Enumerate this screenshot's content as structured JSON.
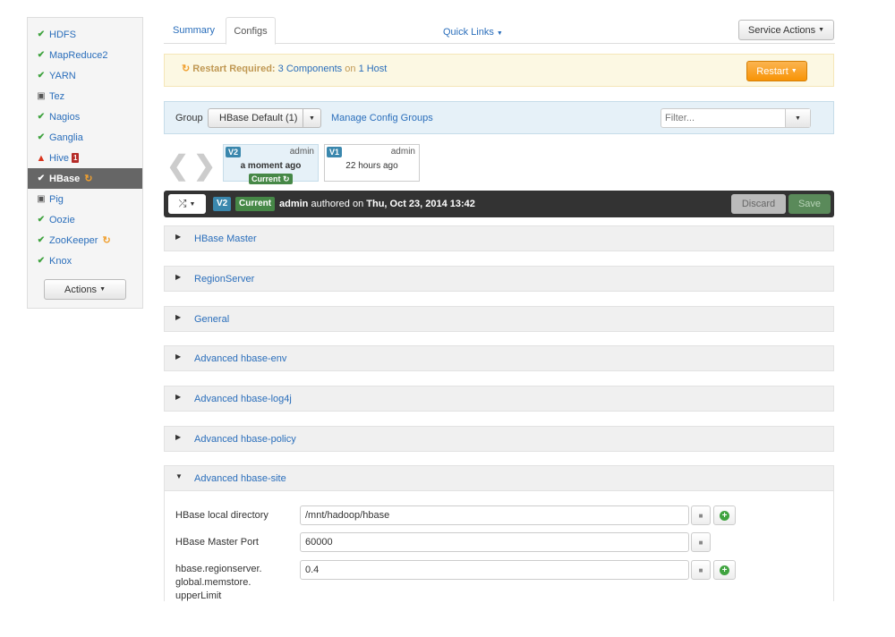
{
  "sidebar": {
    "services": [
      {
        "name": "HDFS",
        "status": "ok"
      },
      {
        "name": "MapReduce2",
        "status": "ok"
      },
      {
        "name": "YARN",
        "status": "ok"
      },
      {
        "name": "Tez",
        "status": "client"
      },
      {
        "name": "Nagios",
        "status": "ok"
      },
      {
        "name": "Ganglia",
        "status": "ok"
      },
      {
        "name": "Hive",
        "status": "alert",
        "badge": "1"
      },
      {
        "name": "HBase",
        "status": "ok",
        "active": true,
        "restart": true
      },
      {
        "name": "Pig",
        "status": "client"
      },
      {
        "name": "Oozie",
        "status": "ok"
      },
      {
        "name": "ZooKeeper",
        "status": "ok",
        "restart": true
      },
      {
        "name": "Knox",
        "status": "ok"
      }
    ],
    "actions_label": "Actions"
  },
  "tabs": {
    "summary": "Summary",
    "configs": "Configs"
  },
  "quick_links": "Quick Links",
  "service_actions": "Service Actions",
  "alert": {
    "prefix": "Restart Required:",
    "components": "3 Components",
    "on": "on",
    "hosts": "1 Host",
    "restart_label": "Restart"
  },
  "group_bar": {
    "label": "Group",
    "selected": "HBase Default (1)",
    "manage_link": "Manage Config Groups",
    "filter_placeholder": "Filter..."
  },
  "versions": {
    "v2": {
      "tag": "V2",
      "author": "admin",
      "time": "a moment ago",
      "current": "Current"
    },
    "v1": {
      "tag": "V1",
      "author": "admin",
      "time": "22 hours ago"
    }
  },
  "version_bar": {
    "tag": "V2",
    "current": "Current",
    "author": "admin",
    "authored_on": "authored on",
    "date": "Thu, Oct 23, 2014 13:42",
    "discard": "Discard",
    "save": "Save"
  },
  "sections": [
    "HBase Master",
    "RegionServer",
    "General",
    "Advanced hbase-env",
    "Advanced hbase-log4j",
    "Advanced hbase-policy",
    "Advanced hbase-site"
  ],
  "properties": [
    {
      "label": "HBase local directory",
      "value": "/mnt/hadoop/hbase",
      "has_add": true
    },
    {
      "label": "HBase Master Port",
      "value": "60000",
      "has_add": false
    },
    {
      "label": "hbase.regionserver.\nglobal.memstore.\nupperLimit",
      "value": "0.4",
      "has_add": true
    }
  ],
  "colors": {
    "link": "#2a6ebb",
    "ok": "#3fa33f",
    "warning_bg": "#fcf8e3",
    "restart_button": "#f89406",
    "version_bar": "#333333"
  },
  "icons": {
    "ok": "check-circle-icon",
    "client": "laptop-icon",
    "alert": "warning-triangle-icon",
    "restart": "refresh-icon",
    "lock": "lock-icon",
    "add": "plus-circle-icon"
  }
}
